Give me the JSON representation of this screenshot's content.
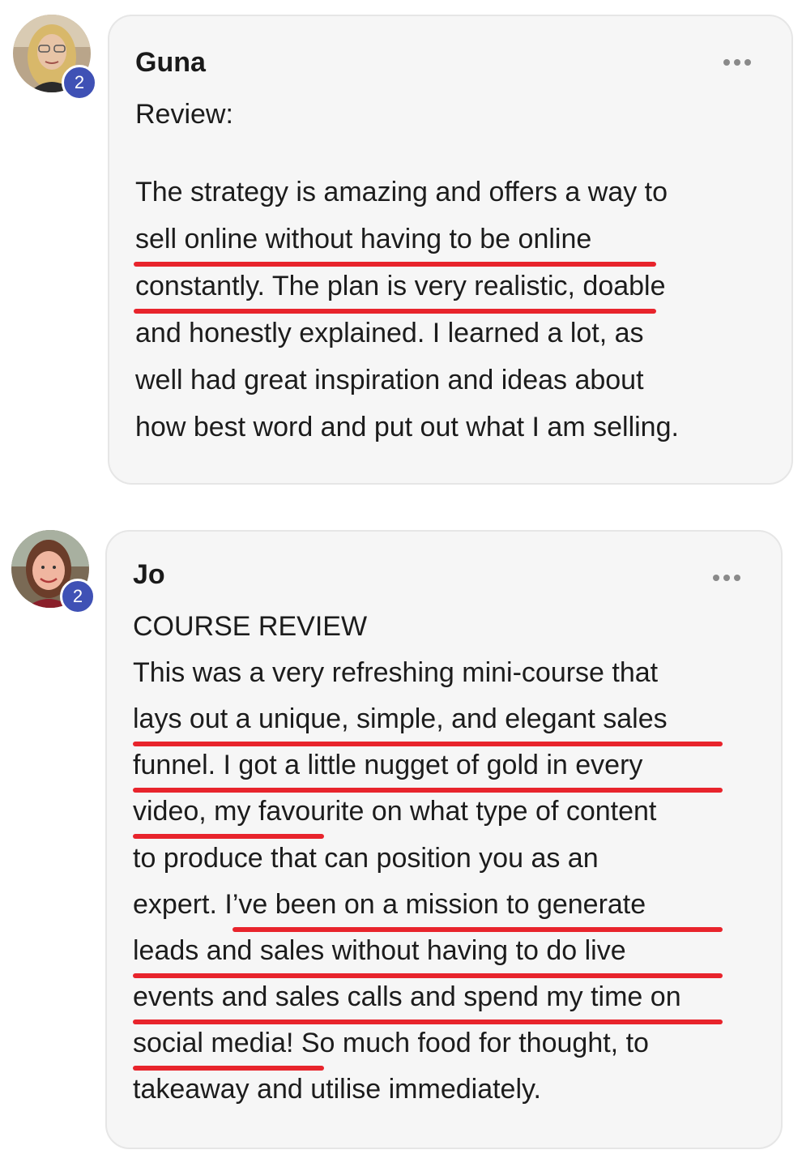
{
  "posts": [
    {
      "author": "Guna",
      "badge": "2",
      "heading": "Review:",
      "lines": [
        "The strategy is amazing and offers a way to",
        "sell online without having to be online",
        "constantly. The plan is very realistic, doable",
        "and honestly explained. I learned a lot, as",
        "well had great inspiration and ideas about",
        "how best word and put out what I am selling."
      ]
    },
    {
      "author": "Jo",
      "badge": "2",
      "heading": "COURSE REVIEW",
      "lines": [
        "This was a very refreshing mini-course that",
        "lays out a unique, simple, and elegant sales",
        "funnel. I got a little nugget of gold in every",
        "video, my favourite on what type of content",
        "to produce that can position you as an",
        "expert. I’ve been on a mission to generate",
        "leads and sales without having to do live",
        "events and sales calls and spend my time on",
        "social media! So much food for thought, to",
        "takeaway and utilise immediately."
      ]
    }
  ],
  "icons": {
    "more": "more-horizontal-icon"
  },
  "colors": {
    "badge": "#3f51b5",
    "underline": "#e8242c",
    "bubble": "#f6f6f6"
  }
}
